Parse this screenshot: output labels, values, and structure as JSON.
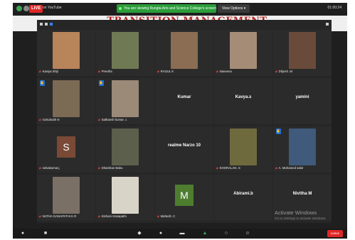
{
  "slide": {
    "title": "TRANSITION MANAGEMENT"
  },
  "topbar": {
    "live_label": "LIVE",
    "live_text": "on YouTube",
    "share_banner": "You are viewing Rungta Arts and Science College's screen",
    "view_options": "View Options ▾",
    "timer": "01:00:24"
  },
  "tiles": [
    {
      "name": "Kaviya Shiji",
      "color": "#b8845a"
    },
    {
      "name": "Preetha",
      "color": "#6f7a55"
    },
    {
      "name": "RAGUL K",
      "color": "#8a6d52"
    },
    {
      "name": "Naveena",
      "color": "#a58c76"
    },
    {
      "name": "Dhjesh .M",
      "color": "#6a4a3a"
    },
    {
      "name": "Gokulnath N",
      "color": "#7b6a54",
      "hand": true
    },
    {
      "name": "Sathaesh kumar .c",
      "color": "#9b8a78",
      "hand": true
    },
    {
      "name": "Kumar",
      "big": true
    },
    {
      "name": "Kavya.s",
      "big": true
    },
    {
      "name": "yamini",
      "big": true
    },
    {
      "name": "selvakumar.j",
      "avatar": "S",
      "avatar_color": "#7a4a36"
    },
    {
      "name": "Dharshan Babu",
      "color": "#5b5f4c"
    },
    {
      "name": "realme Narzo 10",
      "big": true
    },
    {
      "name": "KOORALAN .S",
      "color": "#6e6a3e"
    },
    {
      "name": "A. Mohamed sabir",
      "color": "#3f5a7a",
      "hand": true
    },
    {
      "name": "NATHA GANAPATHI K.R",
      "color": "#7a7065"
    },
    {
      "name": "Kishore Kanapathi",
      "color": "#d8d4c8"
    },
    {
      "name": "Mahesh .C",
      "avatar": "M",
      "avatar_color": "#4e7d2f"
    },
    {
      "name": "Abirami.b",
      "big": true
    },
    {
      "name": "Nivitha M",
      "big": true
    }
  ],
  "watermark": {
    "line1": "Activate Windows",
    "line2": "Go to Settings to activate Windows."
  },
  "bottombar": {
    "end_label": "Leave"
  }
}
